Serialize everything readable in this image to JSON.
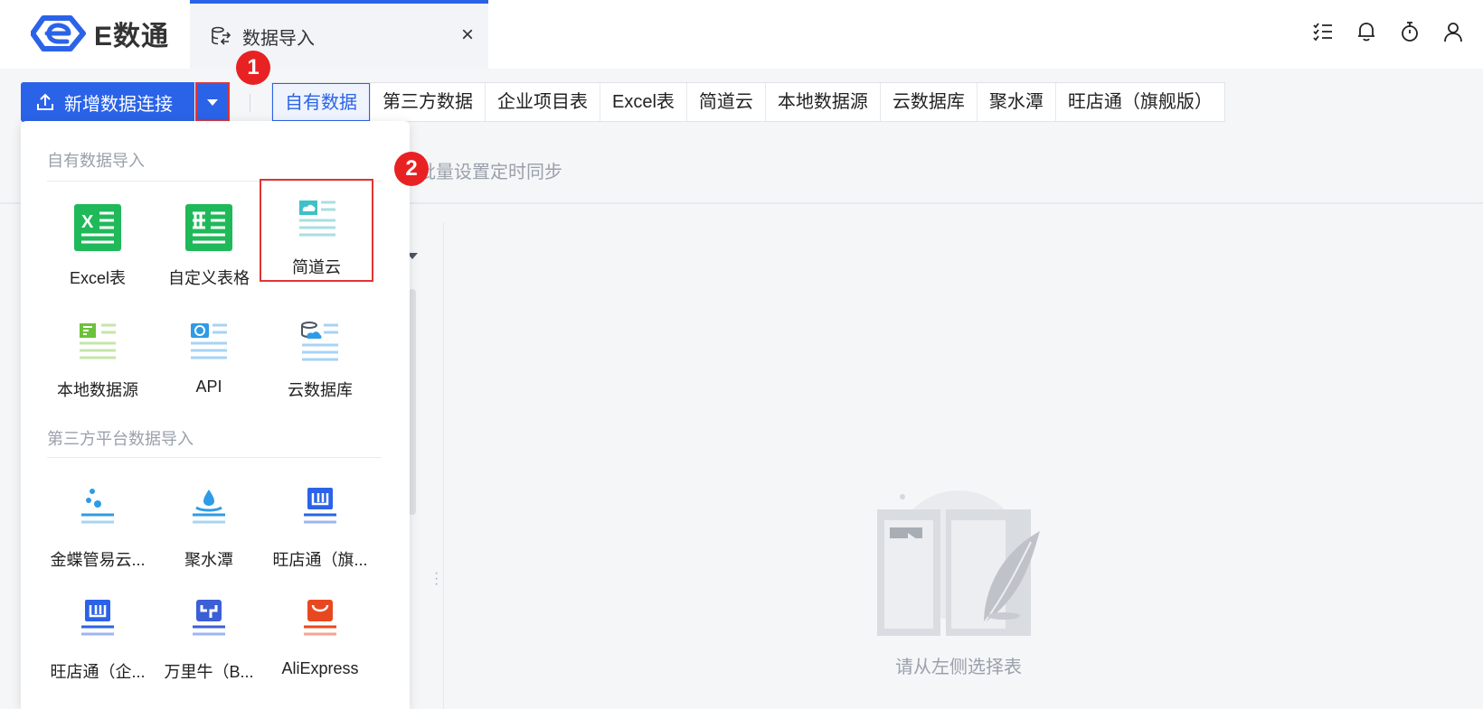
{
  "app": {
    "brand": "E数通",
    "tab_title": "数据导入",
    "tab_close": "×"
  },
  "top_icons": [
    "task-list-icon",
    "bell-icon",
    "timer-icon",
    "user-icon"
  ],
  "toolbar": {
    "add_connection_label": "新增数据连接",
    "filter_tabs": [
      "自有数据",
      "第三方数据",
      "企业项目表",
      "Excel表",
      "简道云",
      "本地数据源",
      "云数据库",
      "聚水潭",
      "旺店通（旗舰版）"
    ],
    "active_filter_index": 0,
    "sync_text": "批量设置定时同步"
  },
  "badges": [
    "1",
    "2"
  ],
  "dropdown": {
    "section1_title": "自有数据导入",
    "section1_items": [
      {
        "label": "Excel表",
        "icon": "excel-icon"
      },
      {
        "label": "自定义表格",
        "icon": "custom-table-icon"
      },
      {
        "label": "简道云",
        "icon": "jiandaoyun-icon"
      },
      {
        "label": "本地数据源",
        "icon": "local-datasource-icon"
      },
      {
        "label": "API",
        "icon": "api-icon"
      },
      {
        "label": "云数据库",
        "icon": "cloud-database-icon"
      }
    ],
    "section2_title": "第三方平台数据导入",
    "section2_items": [
      {
        "label": "金蝶管易云...",
        "icon": "kingdee-icon"
      },
      {
        "label": "聚水潭",
        "icon": "jushuitan-icon"
      },
      {
        "label": "旺店通（旗...",
        "icon": "wangdiantong-flagship-icon"
      },
      {
        "label": "旺店通（企...",
        "icon": "wangdiantong-enterprise-icon"
      },
      {
        "label": "万里牛（B...",
        "icon": "wanliniu-icon"
      },
      {
        "label": "AliExpress",
        "icon": "aliexpress-icon"
      }
    ]
  },
  "main": {
    "empty_text": "请从左侧选择表"
  },
  "colors": {
    "primary": "#2b63e8",
    "highlight_border": "#e23434",
    "badge": "#e82222",
    "excel_green": "#1fb95a"
  }
}
